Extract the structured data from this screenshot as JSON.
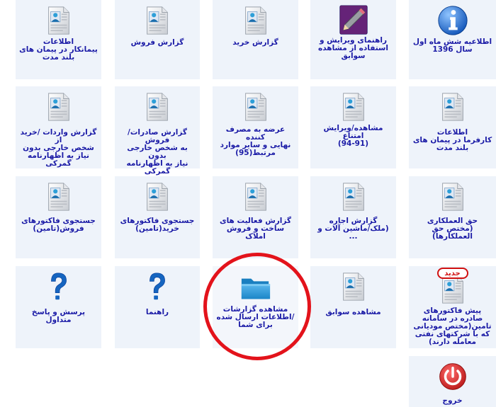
{
  "tiles": {
    "r1c1": {
      "lines": [
        "اطلاعات",
        "پیمانکار در پیمان های",
        "بلند مدت"
      ]
    },
    "r1c2": {
      "lines": [
        "گزارش فروش"
      ]
    },
    "r1c3": {
      "lines": [
        "گزارش خرید"
      ]
    },
    "r1c4": {
      "lines": [
        "راهنمای ویرایش و",
        "استفاده از مشاهده",
        "سوابق"
      ]
    },
    "r1c5": {
      "lines": [
        "اطلاعیه شش ماه اول",
        "سال 1396"
      ]
    },
    "r2c1": {
      "lines": [
        "گزارش واردات /خرید از",
        "شخص خارجی بدون",
        "نیاز به اظهارنامه",
        "گمرکی"
      ]
    },
    "r2c2": {
      "lines": [
        "گزارش صادرات/فروش",
        "به شخص خارجی بدون",
        "نیاز به اظهارنامه",
        "گمرکی"
      ]
    },
    "r2c3": {
      "lines": [
        "عرضه به مصرف کننده",
        "نهایی و سایر موارد",
        "مرتبط(95)"
      ]
    },
    "r2c4": {
      "lines": [
        "مشاهده/ویرایش",
        "امتناع",
        "(94-91)"
      ]
    },
    "r2c5": {
      "lines": [
        "اطلاعات",
        "کارفرما در پیمان های",
        "بلند مدت"
      ]
    },
    "r3c1": {
      "lines": [
        "جستجوی فاکتورهای",
        "فروش(تامین)"
      ]
    },
    "r3c2": {
      "lines": [
        "جستجوی فاکتورهای",
        "خرید(تامین)"
      ]
    },
    "r3c3": {
      "lines": [
        "گزارش فعالیت های",
        "ساخت و فروش املاک"
      ]
    },
    "r3c4": {
      "lines": [
        "گزارش اجاره",
        "(ملک/ماشین آلات و",
        "..."
      ]
    },
    "r3c5": {
      "lines": [
        "حق العملکاری",
        "(مختص حق",
        "العملکارها)"
      ]
    },
    "r4c1": {
      "lines": [
        "پرسش و پاسخ متداول"
      ]
    },
    "r4c2": {
      "lines": [
        "راهنما"
      ]
    },
    "r4c3": {
      "lines": [
        "مشاهده گزارشات",
        "/اطلاعات ارسال شده",
        "برای شما"
      ]
    },
    "r4c4": {
      "lines": [
        "مشاهده سوابق"
      ]
    },
    "r4c5": {
      "badge": "جدید",
      "lines": [
        "پیش فاکتورهای",
        "صادره در سامانه",
        "تامین(مختص مودیانی",
        "که با شرکتهای نفتی",
        "معامله دارند)"
      ]
    },
    "r5c5": {
      "lines": [
        "خروج"
      ]
    }
  },
  "icons": {
    "document": "document-person-icon",
    "pencil": "pencil-book-icon",
    "info": "info-icon",
    "help": "question-mark-icon",
    "folder": "folder-icon",
    "power": "power-icon"
  },
  "colors": {
    "tile_bg": "#eef3fa",
    "label": "#1a1aa6",
    "highlight_circle": "#e3131b",
    "badge": "#d01010"
  }
}
